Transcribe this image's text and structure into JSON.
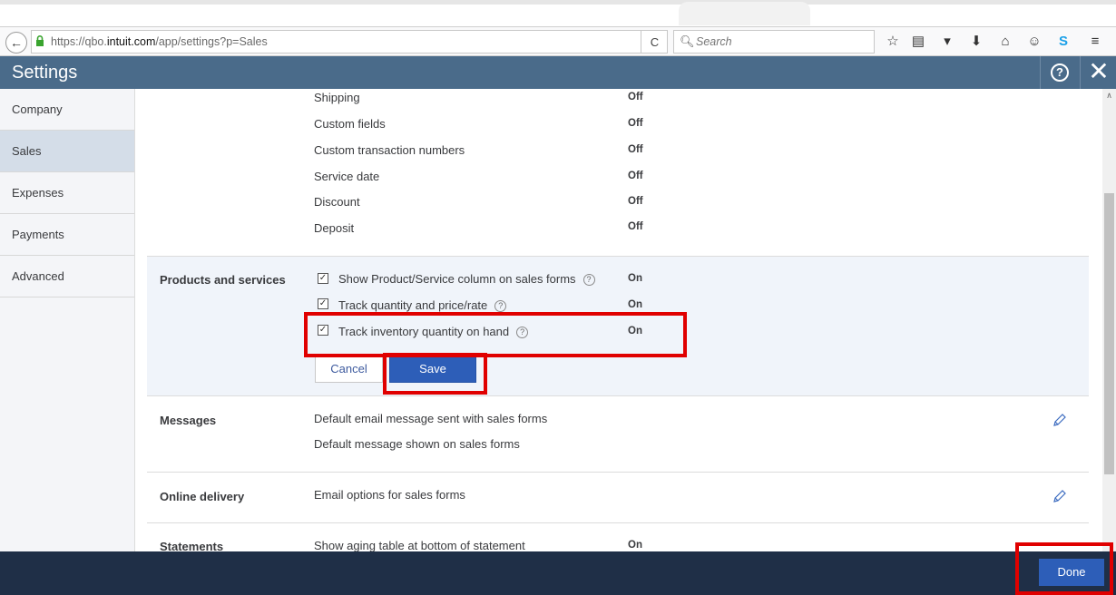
{
  "browser": {
    "url_prefix": "https://qbo.",
    "url_host": "intuit.com",
    "url_path": "/app/settings?p=Sales",
    "reload_glyph": "C",
    "search_placeholder": "Search"
  },
  "header": {
    "title": "Settings",
    "help_label": "?",
    "close_label": "✕"
  },
  "sidebar": {
    "items": [
      {
        "label": "Company"
      },
      {
        "label": "Sales"
      },
      {
        "label": "Expenses"
      },
      {
        "label": "Payments"
      },
      {
        "label": "Advanced"
      }
    ],
    "active": "Sales"
  },
  "form_content": {
    "rows": [
      {
        "label": "Shipping",
        "value": "Off"
      },
      {
        "label": "Custom fields",
        "value": "Off"
      },
      {
        "label": "Custom transaction numbers",
        "value": "Off"
      },
      {
        "label": "Service date",
        "value": "Off"
      },
      {
        "label": "Discount",
        "value": "Off"
      },
      {
        "label": "Deposit",
        "value": "Off"
      }
    ]
  },
  "products_services": {
    "title": "Products and services",
    "options": [
      {
        "label": "Show Product/Service column on sales forms",
        "value": "On",
        "checked": true
      },
      {
        "label": "Track quantity and price/rate",
        "value": "On",
        "checked": true
      },
      {
        "label": "Track inventory quantity on hand",
        "value": "On",
        "checked": true
      }
    ],
    "cancel_label": "Cancel",
    "save_label": "Save"
  },
  "messages": {
    "title": "Messages",
    "rows": [
      "Default email message sent with sales forms",
      "Default message shown on sales forms"
    ]
  },
  "online_delivery": {
    "title": "Online delivery",
    "rows": [
      "Email options for sales forms"
    ]
  },
  "statements": {
    "title": "Statements",
    "row": "Show aging table at bottom of statement",
    "value": "On"
  },
  "footer": {
    "done_label": "Done"
  },
  "colors": {
    "header_bg": "#4a6b8a",
    "footer_bg": "#1f2f47",
    "primary_button": "#2d5eb8",
    "annotation_red": "#e00000"
  },
  "icons": {
    "back": "back-arrow-icon",
    "lock": "lock-icon",
    "reload": "reload-icon",
    "search": "search-icon",
    "bookmark": "star-icon",
    "reading_list": "reading-list-icon",
    "pocket": "pocket-icon",
    "download": "download-icon",
    "home": "home-icon",
    "chat": "chat-icon",
    "skype": "skype-icon",
    "menu": "hamburger-menu-icon",
    "help": "help-icon",
    "close": "close-icon",
    "edit": "pencil-icon"
  }
}
